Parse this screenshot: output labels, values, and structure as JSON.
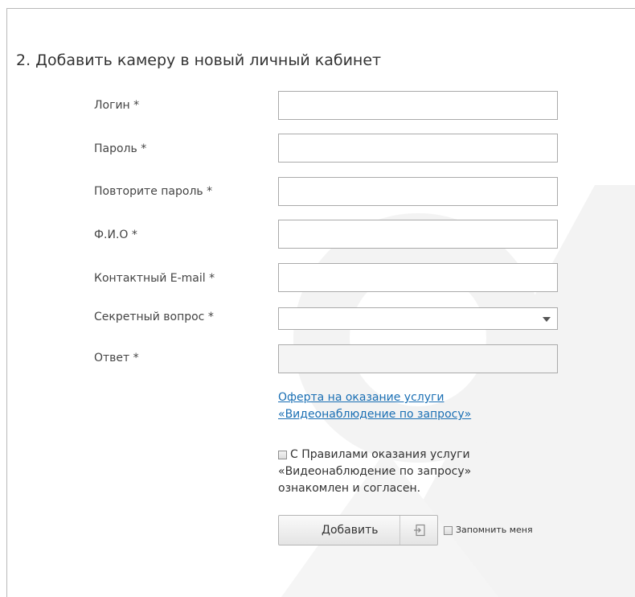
{
  "form": {
    "title": "2. Добавить камеру в новый личный кабинет",
    "fields": {
      "login": {
        "label": "Логин *",
        "value": ""
      },
      "password": {
        "label": "Пароль *",
        "value": ""
      },
      "password_repeat": {
        "label": "Повторите пароль *",
        "value": ""
      },
      "full_name": {
        "label": "Ф.И.О *",
        "value": ""
      },
      "email": {
        "label": "Контактный E-mail *",
        "value": ""
      },
      "secret_question": {
        "label": "Секретный вопрос *",
        "value": ""
      },
      "answer": {
        "label": "Ответ *",
        "value": ""
      }
    },
    "offer_link": {
      "line1": "Оферта на оказание услуги",
      "line2": "«Видеонаблюдение по запросу»"
    },
    "agreement": {
      "line1": "С Правилами оказания услуги",
      "line2": "«Видеонаблюдение по запросу»",
      "line3": "ознакомлен и согласен.",
      "checked": false
    },
    "add_button": {
      "label": "Добавить",
      "icon": "login-icon"
    },
    "remember_me": {
      "label": "Запомнить меня",
      "checked": false
    }
  },
  "colors": {
    "link": "#1a6fb4",
    "text": "#333333",
    "border": "#aaaaaa",
    "watermark": "#f2f2f2"
  }
}
